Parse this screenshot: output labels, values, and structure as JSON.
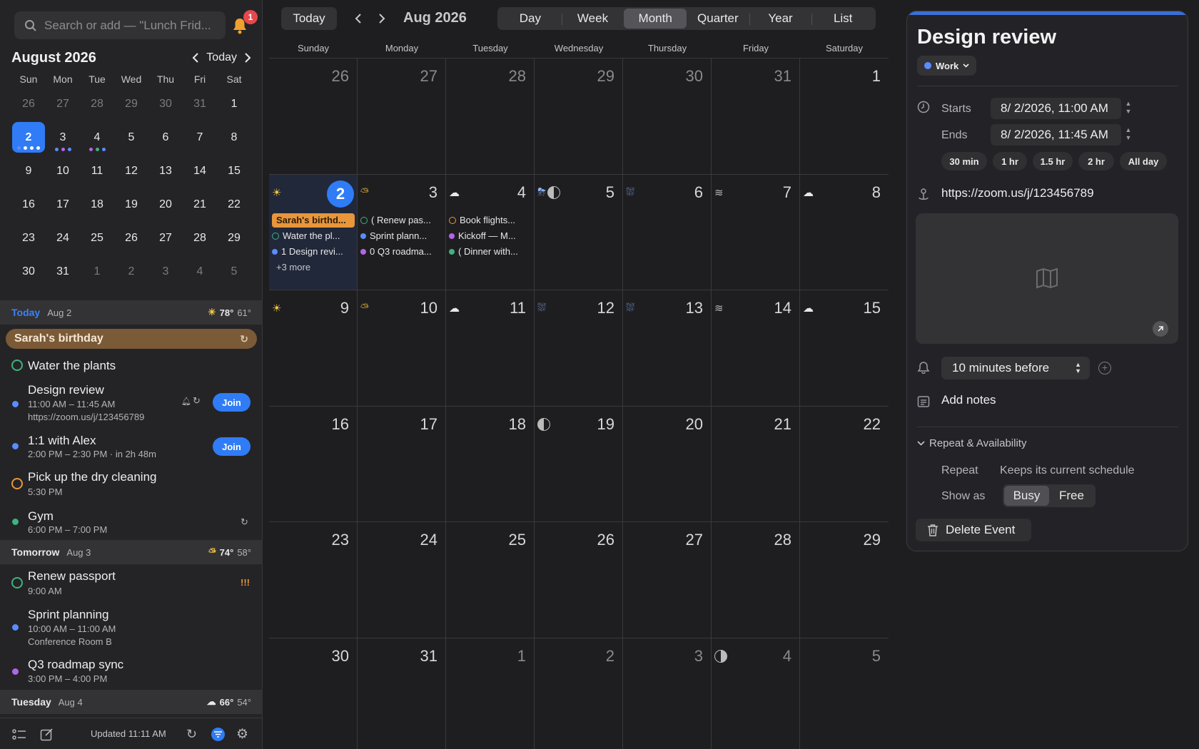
{
  "sidebar": {
    "search_placeholder": "Search or add — \"Lunch Frid...",
    "notification_count": "1",
    "mini": {
      "title": "August 2026",
      "today_label": "Today",
      "dow": [
        "Sun",
        "Mon",
        "Tue",
        "Wed",
        "Thu",
        "Fri",
        "Sat"
      ],
      "weeks": [
        [
          "26",
          "27",
          "28",
          "29",
          "30",
          "31",
          "1"
        ],
        [
          "2",
          "3",
          "4",
          "5",
          "6",
          "7",
          "8"
        ],
        [
          "9",
          "10",
          "11",
          "12",
          "13",
          "14",
          "15"
        ],
        [
          "16",
          "17",
          "18",
          "19",
          "20",
          "21",
          "22"
        ],
        [
          "23",
          "24",
          "25",
          "26",
          "27",
          "28",
          "29"
        ],
        [
          "30",
          "31",
          "1",
          "2",
          "3",
          "4",
          "5"
        ]
      ]
    },
    "today": {
      "label": "Today",
      "date": "Aug 2",
      "hi": "78°",
      "lo": "61°"
    },
    "birthday": "Sarah's birthday",
    "items_today": [
      {
        "title": "Water the plants"
      },
      {
        "title": "Design review",
        "time": "11:00 AM – 11:45 AM",
        "url": "https://zoom.us/j/123456789",
        "join": "Join"
      },
      {
        "title": "1:1 with Alex",
        "time": "2:00 PM – 2:30 PM · in 2h 48m",
        "join": "Join"
      },
      {
        "title": "Pick up the dry cleaning",
        "time": "5:30 PM"
      },
      {
        "title": "Gym",
        "time": "6:00 PM – 7:00 PM"
      }
    ],
    "tomorrow": {
      "label": "Tomorrow",
      "date": "Aug 3",
      "hi": "74°",
      "lo": "58°"
    },
    "items_tomorrow": [
      {
        "title": "Renew passport",
        "time": "9:00 AM",
        "priority": "!!!"
      },
      {
        "title": "Sprint planning",
        "time": "10:00 AM – 11:00 AM",
        "location": "Conference Room B"
      },
      {
        "title": "Q3 roadmap sync",
        "time": "3:00 PM – 4:00 PM"
      }
    ],
    "tuesday": {
      "label": "Tuesday",
      "date": "Aug 4",
      "hi": "66°",
      "lo": "54°"
    },
    "footer": {
      "updated": "Updated 11:11 AM"
    }
  },
  "toolbar": {
    "today": "Today",
    "period": "Aug 2026",
    "views": [
      "Day",
      "Week",
      "Month",
      "Quarter",
      "Year",
      "List"
    ],
    "active_view": "Month"
  },
  "month": {
    "dow": [
      "Sunday",
      "Monday",
      "Tuesday",
      "Wednesday",
      "Thursday",
      "Friday",
      "Saturday"
    ],
    "weeks": [
      [
        "26",
        "27",
        "28",
        "29",
        "30",
        "31",
        "1"
      ],
      [
        "2",
        "3",
        "4",
        "5",
        "6",
        "7",
        "8"
      ],
      [
        "9",
        "10",
        "11",
        "12",
        "13",
        "14",
        "15"
      ],
      [
        "16",
        "17",
        "18",
        "19",
        "20",
        "21",
        "22"
      ],
      [
        "23",
        "24",
        "25",
        "26",
        "27",
        "28",
        "29"
      ],
      [
        "30",
        "31",
        "1",
        "2",
        "3",
        "4",
        "5"
      ]
    ],
    "events": {
      "sun": [
        "Sarah's birthd...",
        "Water the pl...",
        "1 Design revi..."
      ],
      "sun_more": "+3 more",
      "mon": [
        "( Renew pas...",
        "Sprint plann...",
        "0 Q3 roadma..."
      ],
      "tue": [
        "Book flights...",
        "Kickoff — M...",
        "( Dinner with..."
      ]
    }
  },
  "inspector": {
    "title": "Design review",
    "calendar": "Work",
    "starts_label": "Starts",
    "starts_value": "8/  2/2026, 11:00 AM",
    "ends_label": "Ends",
    "ends_value": "8/  2/2026, 11:45 AM",
    "durations": [
      "30 min",
      "1 hr",
      "1.5 hr",
      "2 hr",
      "All day"
    ],
    "url": "https://zoom.us/j/123456789",
    "alert": "10 minutes before",
    "notes": "Add notes",
    "repeat_header": "Repeat & Availability",
    "repeat_label": "Repeat",
    "repeat_value": "Keeps its current schedule",
    "show_as_label": "Show as",
    "show_as": [
      "Busy",
      "Free"
    ],
    "delete": "Delete Event"
  },
  "colors": {
    "accent": "#2f7cf6",
    "work": "#5b8cff",
    "purple": "#b464e8",
    "green": "#3fb27f",
    "orange": "#e8963c"
  }
}
